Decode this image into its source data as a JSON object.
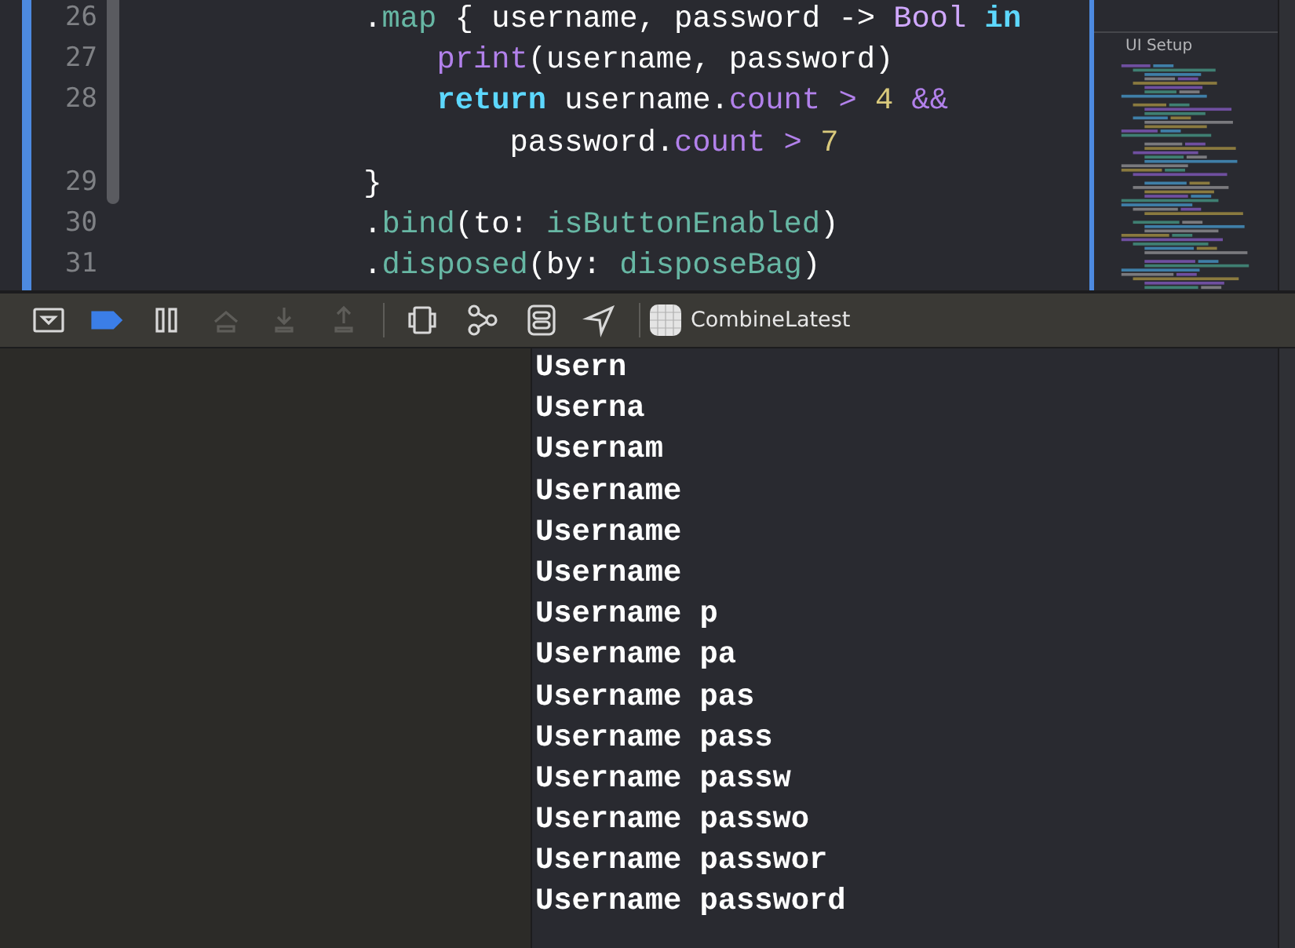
{
  "editor": {
    "lines": [
      {
        "number": "26",
        "tokens": [
          {
            "kind": "plain",
            "text": "            ."
          },
          {
            "kind": "method",
            "text": "map"
          },
          {
            "kind": "plain",
            "text": " { username, password -> "
          },
          {
            "kind": "type",
            "text": "Bool"
          },
          {
            "kind": "keyword",
            "text": " in"
          }
        ]
      },
      {
        "number": "27",
        "tokens": [
          {
            "kind": "function",
            "text": "                print"
          },
          {
            "kind": "plain",
            "text": "(username, password)"
          }
        ]
      },
      {
        "number": "28",
        "tokens": [
          {
            "kind": "keyword",
            "text": "                return"
          },
          {
            "kind": "plain",
            "text": " username."
          },
          {
            "kind": "property",
            "text": "count"
          },
          {
            "kind": "operator",
            "text": " >"
          },
          {
            "kind": "number",
            "text": " 4"
          },
          {
            "kind": "operator",
            "text": " &&"
          }
        ]
      },
      {
        "tokens": [
          {
            "kind": "plain",
            "text": "                    password."
          },
          {
            "kind": "property",
            "text": "count"
          },
          {
            "kind": "operator",
            "text": " >"
          },
          {
            "kind": "number",
            "text": " 7"
          }
        ]
      },
      {
        "number": "29",
        "tokens": [
          {
            "kind": "plain",
            "text": "            }"
          }
        ]
      },
      {
        "number": "30",
        "tokens": [
          {
            "kind": "plain",
            "text": "            ."
          },
          {
            "kind": "method",
            "text": "bind"
          },
          {
            "kind": "plain",
            "text": "(to: "
          },
          {
            "kind": "identifier",
            "text": "isButtonEnabled"
          },
          {
            "kind": "plain",
            "text": ")"
          }
        ]
      },
      {
        "number": "31",
        "tokens": [
          {
            "kind": "plain",
            "text": "            ."
          },
          {
            "kind": "method",
            "text": "disposed"
          },
          {
            "kind": "plain",
            "text": "(by: "
          },
          {
            "kind": "identifier",
            "text": "disposeBag"
          },
          {
            "kind": "plain",
            "text": ")"
          }
        ]
      }
    ]
  },
  "minimap": {
    "section_label": "UI Setup"
  },
  "debug_bar": {
    "breakpoints_active": true,
    "buttons": [
      {
        "kind": "hide-console",
        "disabled": false
      },
      {
        "kind": "breakpoints",
        "disabled": false
      },
      {
        "kind": "pause",
        "disabled": false
      },
      {
        "kind": "step-over",
        "disabled": true
      },
      {
        "kind": "step-into",
        "disabled": true
      },
      {
        "kind": "step-out",
        "disabled": true
      },
      {
        "kind": "view-debugger",
        "disabled": false
      },
      {
        "kind": "memory-graph",
        "disabled": false
      },
      {
        "kind": "environment",
        "disabled": false
      },
      {
        "kind": "location",
        "disabled": false
      }
    ],
    "target": "CombineLatest"
  },
  "console": {
    "lines": [
      "Usern",
      "Userna",
      "Usernam",
      "Username",
      "Username",
      "Username",
      "Username p",
      "Username pa",
      "Username pas",
      "Username pass",
      "Username passw",
      "Username passwo",
      "Username passwor",
      "Username password"
    ]
  }
}
